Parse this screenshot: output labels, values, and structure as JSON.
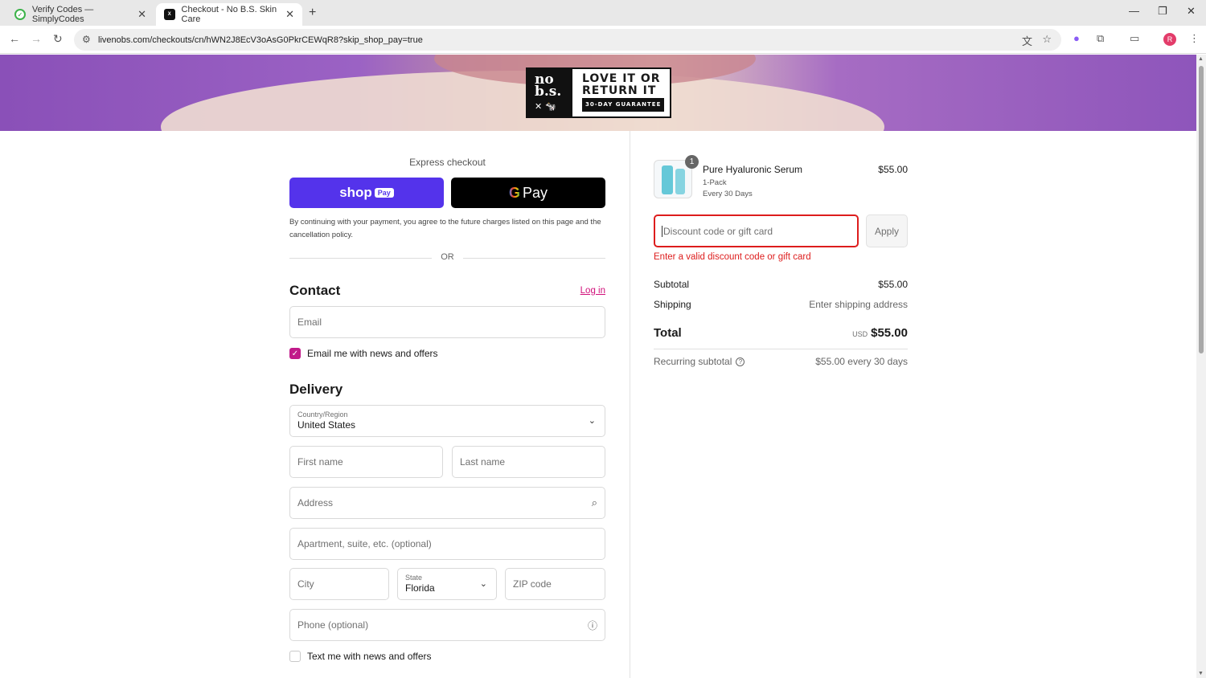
{
  "browser": {
    "tabs": [
      {
        "title": "Verify Codes — SimplyCodes",
        "active": false
      },
      {
        "title": "Checkout - No B.S. Skin Care",
        "active": true
      }
    ],
    "url": "livenobs.com/checkouts/cn/hWN2J8EcV3oAsG0PkrCEWqR8?skip_shop_pay=true",
    "profile_initial": "R"
  },
  "banner": {
    "logo_line1": "no",
    "logo_line2": "b.s.",
    "logo_mark": "✕ 🐄",
    "line1": "LOVE IT OR",
    "line2": "RETURN IT",
    "guarantee": "30-DAY GUARANTEE"
  },
  "express": {
    "title": "Express checkout",
    "shoppay_label": "shop",
    "shoppay_badge": "Pay",
    "gpay_g": "G",
    "gpay_label": "Pay",
    "terms": "By continuing with your payment, you agree to the future charges listed on this page and the cancellation policy.",
    "or": "OR"
  },
  "contact": {
    "heading": "Contact",
    "login": "Log in",
    "email_placeholder": "Email",
    "news_checkbox": "Email me with news and offers",
    "news_checked": true
  },
  "delivery": {
    "heading": "Delivery",
    "country_label": "Country/Region",
    "country_value": "United States",
    "first_name": "First name",
    "last_name": "Last name",
    "address": "Address",
    "apartment": "Apartment, suite, etc. (optional)",
    "city": "City",
    "state_label": "State",
    "state_value": "Florida",
    "zip": "ZIP code",
    "phone": "Phone (optional)",
    "text_checkbox": "Text me with news and offers",
    "text_checked": false
  },
  "summary": {
    "product": {
      "name": "Pure Hyaluronic Serum",
      "variant": "1-Pack",
      "frequency": "Every 30 Days",
      "price": "$55.00",
      "quantity": "1"
    },
    "discount_placeholder": "Discount code or gift card",
    "apply": "Apply",
    "discount_error": "Enter a valid discount code or gift card",
    "subtotal_label": "Subtotal",
    "subtotal_value": "$55.00",
    "shipping_label": "Shipping",
    "shipping_value": "Enter shipping address",
    "total_label": "Total",
    "currency": "USD",
    "total_value": "$55.00",
    "recurring_label": "Recurring subtotal",
    "recurring_value": "$55.00 every 30 days"
  },
  "colors": {
    "shoppay": "#5433eb",
    "accent": "#c11a8a",
    "error": "#dd1d1d"
  }
}
